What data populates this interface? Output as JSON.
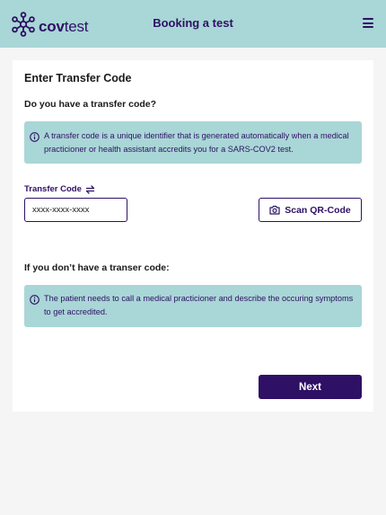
{
  "header": {
    "logo_bold": "cov",
    "logo_light": "test",
    "title": "Booking a test",
    "menu_icon": "hamburger-menu-icon"
  },
  "card": {
    "title": "Enter Transfer Code",
    "question": "Do you have a transfer code?",
    "info_1": "A transfer code is a unique identifier that is generated automatically when a medical practicioner or health assistant accredits you for a SARS-COV2 test.",
    "field_label": "Transfer Code",
    "field_placeholder": "xxxx-xxxx-xxxx",
    "scan_button": "Scan QR-Code",
    "no_code_heading": "If you don’t have a transer code:",
    "info_2": "The patient needs to call a medical practicioner and describe the occuring symptoms to get accredited.",
    "next_button": "Next"
  },
  "colors": {
    "header_bg": "#a9d6d6",
    "brand_dark": "#2e1065",
    "info_bg": "#a9d6d6",
    "page_bg": "#f5f5f5"
  },
  "icons": [
    "logo-molecule-icon",
    "hamburger-menu-icon",
    "info-icon",
    "swap-arrows-icon",
    "camera-icon"
  ]
}
